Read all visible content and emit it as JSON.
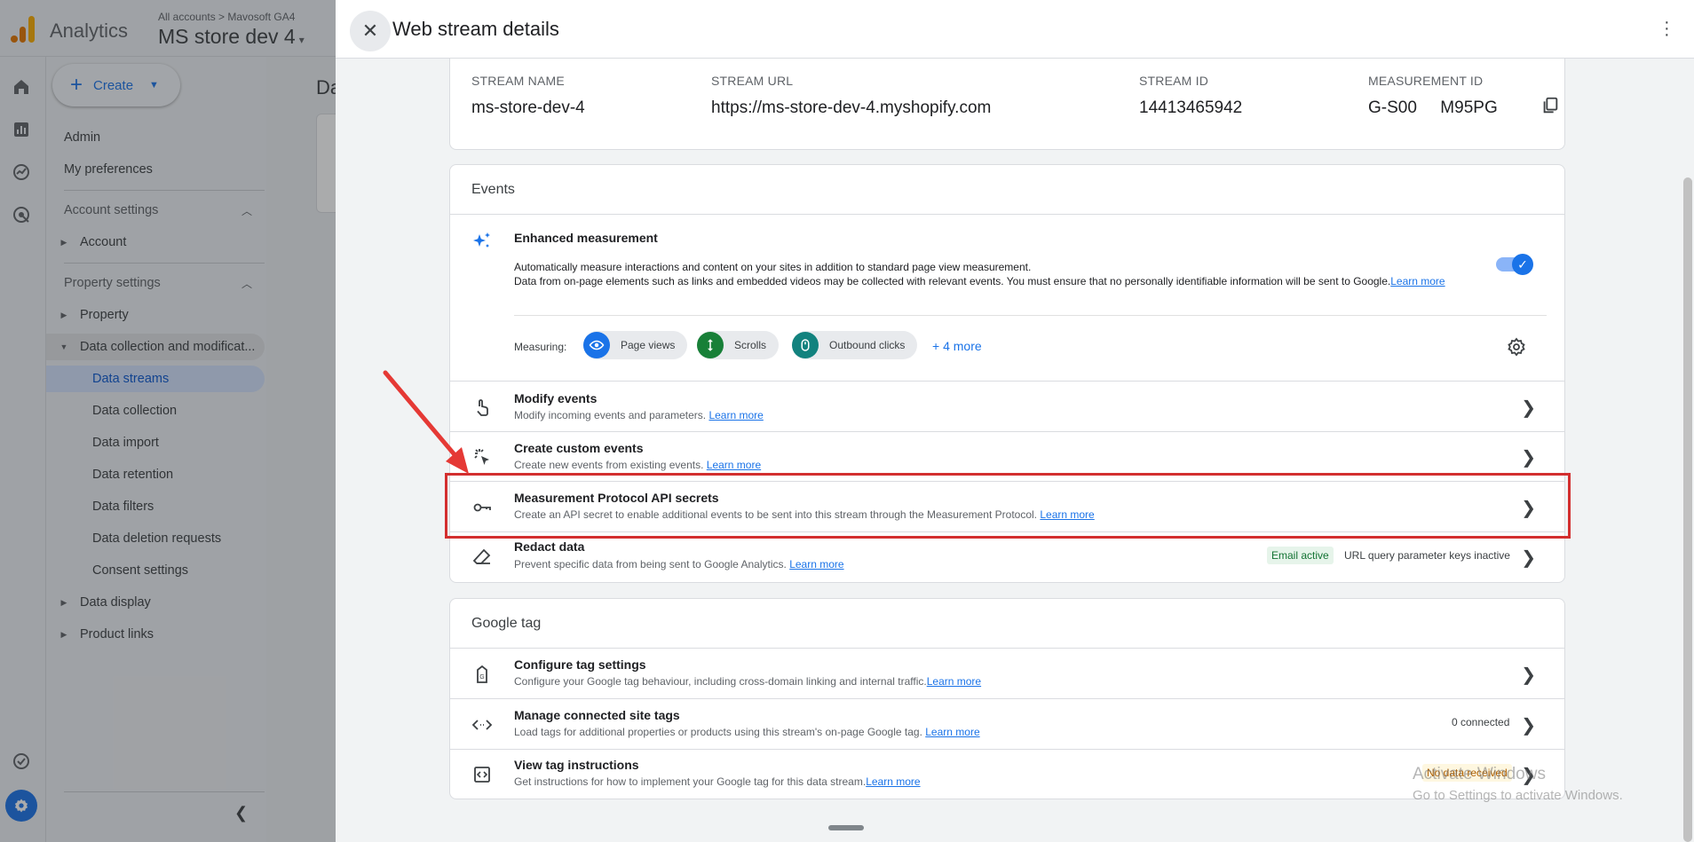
{
  "app": {
    "title": "Analytics",
    "breadcrumb": "All accounts > Mavosoft GA4",
    "property": "MS store dev 4",
    "property_caret": "▾"
  },
  "nav": {
    "create_label": "Create",
    "admin": "Admin",
    "my_preferences": "My preferences",
    "account_settings": "Account settings",
    "account": "Account",
    "property_settings": "Property settings",
    "property": "Property",
    "data_collection_modification": "Data collection and modificat...",
    "data_streams": "Data streams",
    "data_collection": "Data collection",
    "data_import": "Data import",
    "data_retention": "Data retention",
    "data_filters": "Data filters",
    "data_deletion_requests": "Data deletion requests",
    "consent_settings": "Consent settings",
    "data_display": "Data display",
    "product_links": "Product links"
  },
  "background": {
    "content_title": "Da"
  },
  "panel": {
    "title": "Web stream details"
  },
  "stream": {
    "name_label": "STREAM NAME",
    "name_value": "ms-store-dev-4",
    "url_label": "STREAM URL",
    "url_value": "https://ms-store-dev-4.myshopify.com",
    "id_label": "STREAM ID",
    "id_value": "14413465942",
    "measurement_label": "MEASUREMENT ID",
    "measurement_value": "G-S00     M95PG"
  },
  "events": {
    "header": "Events",
    "enhanced_title": "Enhanced measurement",
    "enhanced_desc1": "Automatically measure interactions and content on your sites in addition to standard page view measurement.",
    "enhanced_desc2": "Data from on-page elements such as links and embedded videos may be collected with relevant events. You must ensure that no personally identifiable information will be sent to Google.",
    "learn_more": "Learn more",
    "measuring_label": "Measuring:",
    "chips": [
      "Page views",
      "Scrolls",
      "Outbound clicks"
    ],
    "more": "+ 4 more",
    "enhanced_enabled": true,
    "rows": [
      {
        "title": "Modify events",
        "desc": "Modify incoming events and parameters."
      },
      {
        "title": "Create custom events",
        "desc": "Create new events from existing events."
      },
      {
        "title": "Measurement Protocol API secrets",
        "desc": "Create an API secret to enable additional events to be sent into this stream through the Measurement Protocol."
      },
      {
        "title": "Redact data",
        "desc": "Prevent specific data from being sent to Google Analytics.",
        "badge1": "Email active",
        "badge2": "URL query parameter keys inactive"
      }
    ]
  },
  "google_tag": {
    "header": "Google tag",
    "rows": [
      {
        "title": "Configure tag settings",
        "desc": "Configure your Google tag behaviour, including cross-domain linking and internal traffic."
      },
      {
        "title": "Manage connected site tags",
        "desc": "Load tags for additional properties or products using this stream's on-page Google tag.",
        "status": "0 connected"
      },
      {
        "title": "View tag instructions",
        "desc": "Get instructions for how to implement your Google tag for this data stream.",
        "status": "No data received"
      }
    ]
  },
  "watermark": {
    "line1": "Activate Windows",
    "line2": "Go to Settings to activate Windows."
  },
  "colors": {
    "accent": "#1a73e8",
    "highlight_box": "#d32f2f",
    "chip_page_views": "#1a73e8",
    "chip_scrolls": "#188038",
    "chip_outbound": "#12827e"
  }
}
